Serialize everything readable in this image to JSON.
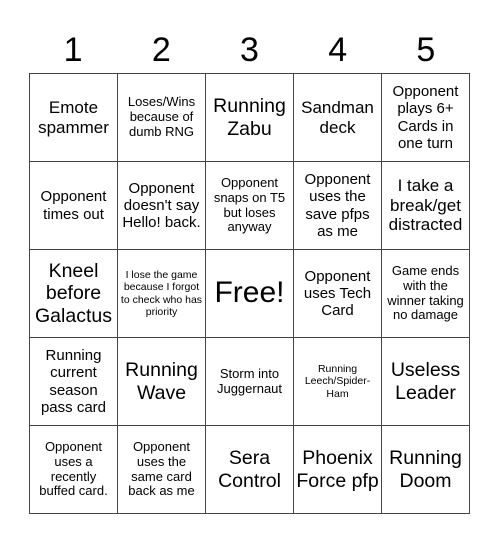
{
  "header": [
    "1",
    "2",
    "3",
    "4",
    "5"
  ],
  "cells": [
    [
      "Emote spammer",
      "Loses/Wins because of dumb RNG",
      "Running Zabu",
      "Sandman deck",
      "Opponent plays 6+ Cards in one turn"
    ],
    [
      "Opponent times out",
      "Opponent doesn't say Hello! back.",
      "Opponent snaps on T5 but loses anyway",
      "Opponent uses the save pfps as me",
      "I take a break/get distracted"
    ],
    [
      "Kneel before Galactus",
      "I lose the game because I forgot to check who has priority",
      "Free!",
      "Opponent uses Tech Card",
      "Game ends with the winner taking no damage"
    ],
    [
      "Running current season pass card",
      "Running Wave",
      "Storm into Juggernaut",
      "Running Leech/Spider-Ham",
      "Useless Leader"
    ],
    [
      "Opponent uses a recently buffed card.",
      "Opponent uses the same card back as me",
      "Sera Control",
      "Phoenix Force pfp",
      "Running Doom"
    ]
  ],
  "colors": {
    "grid_line": "#444444",
    "background": "#ffffff",
    "text": "#000000"
  }
}
